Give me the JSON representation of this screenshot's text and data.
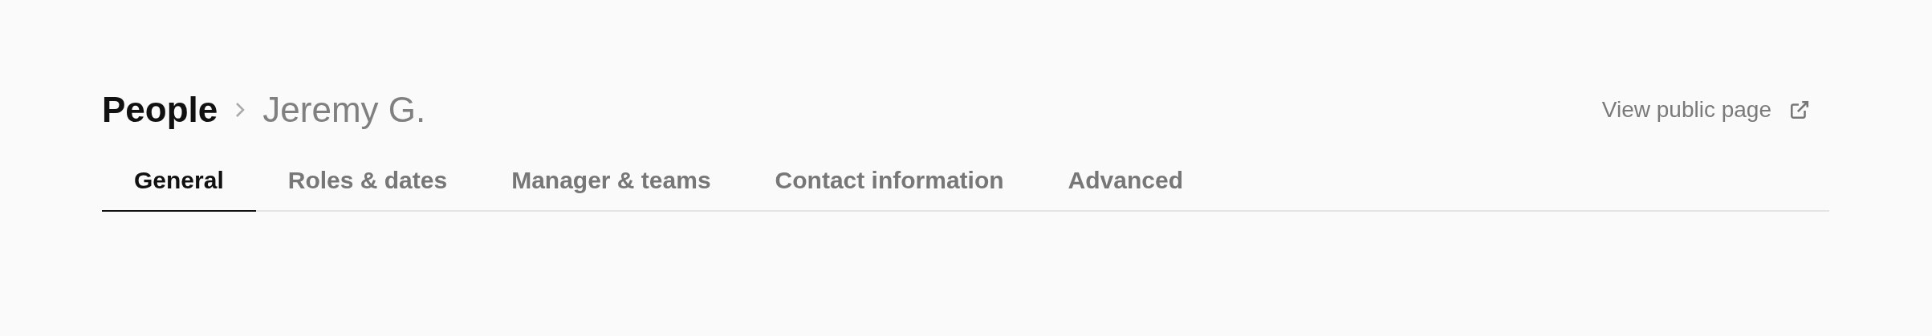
{
  "breadcrumb": [
    {
      "label": "People",
      "current": false
    },
    {
      "label": "Jeremy G.",
      "current": true
    }
  ],
  "public_link": {
    "label": "View public page"
  },
  "tabs": [
    {
      "label": "General",
      "selected": true
    },
    {
      "label": "Roles & dates",
      "selected": false
    },
    {
      "label": "Manager & teams",
      "selected": false
    },
    {
      "label": "Contact information",
      "selected": false
    },
    {
      "label": "Advanced",
      "selected": false
    }
  ]
}
